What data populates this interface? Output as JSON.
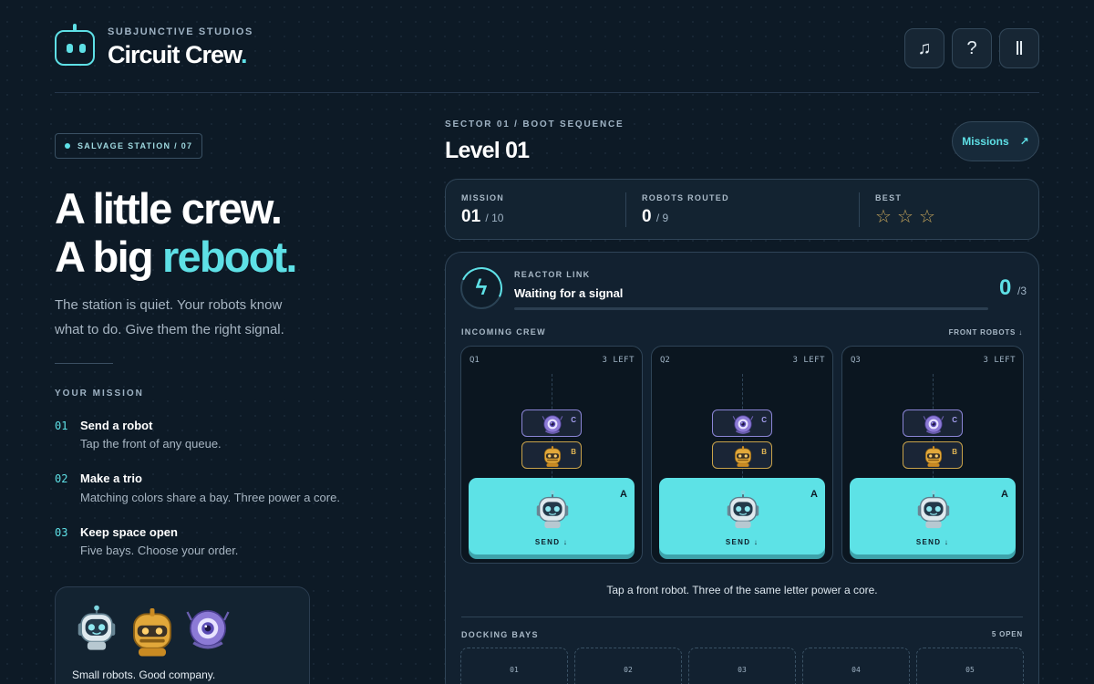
{
  "brand": {
    "studio": "SUBJUNCTIVE STUDIOS",
    "title": "Circuit Crew",
    "title_dot": "."
  },
  "header_buttons": {
    "music": "♫",
    "help": "?",
    "pause": "Ⅱ"
  },
  "left": {
    "badge": "SALVAGE STATION / 07",
    "hero_line1": "A little crew.",
    "hero_line2_pre": "A big ",
    "hero_line2_accent": "reboot.",
    "description": "The station is quiet. Your robots know what to do. Give them the right signal.",
    "mission_heading": "YOUR MISSION",
    "steps": [
      {
        "num": "01",
        "title": "Send a robot",
        "desc": "Tap the front of any queue."
      },
      {
        "num": "02",
        "title": "Make a trio",
        "desc": "Matching colors share a bay. Three power a core."
      },
      {
        "num": "03",
        "title": "Keep space open",
        "desc": "Five bays. Choose your order."
      }
    ],
    "crew_caption": "Small robots. Good company."
  },
  "level": {
    "sector": "SECTOR 01 / BOOT SEQUENCE",
    "title": "Level 01",
    "missions_button": "Missions",
    "missions_arrow": "↗"
  },
  "stats": {
    "mission_label": "MISSION",
    "mission_value": "01",
    "mission_total": "/ 10",
    "routed_label": "ROBOTS ROUTED",
    "routed_value": "0",
    "routed_total": "/ 9",
    "best_label": "BEST",
    "stars_filled": 0,
    "stars_total": 3
  },
  "reactor": {
    "icon": "ϟ",
    "label": "REACTOR LINK",
    "status": "Waiting for a signal",
    "progress": 0,
    "count": "0",
    "count_total": "/3"
  },
  "incoming": {
    "label": "INCOMING CREW",
    "right_label": "FRONT ROBOTS ↓",
    "queues": [
      {
        "id": "Q1",
        "left": "3 LEFT",
        "front_letter": "A",
        "b_letter": "B",
        "c_letter": "C",
        "send": "SEND ↓"
      },
      {
        "id": "Q2",
        "left": "3 LEFT",
        "front_letter": "A",
        "b_letter": "B",
        "c_letter": "C",
        "send": "SEND ↓"
      },
      {
        "id": "Q3",
        "left": "3 LEFT",
        "front_letter": "A",
        "b_letter": "B",
        "c_letter": "C",
        "send": "SEND ↓"
      }
    ]
  },
  "hint": "Tap a front robot. Three of the same letter power a core.",
  "docking": {
    "label": "DOCKING BAYS",
    "open": "5 OPEN",
    "bays": [
      "01",
      "02",
      "03",
      "04",
      "05"
    ]
  },
  "colors": {
    "accent": "#5ee0e6",
    "robot_a": "#5de2e6",
    "robot_b": "#e2a83a",
    "robot_c": "#8c7ad6",
    "star": "#c3a35a"
  }
}
